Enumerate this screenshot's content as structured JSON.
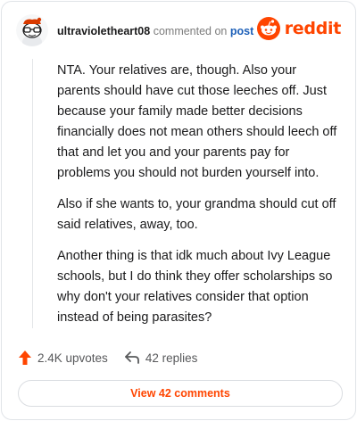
{
  "header": {
    "username": "ultravioletheart08",
    "action_text": "commented on",
    "post_link": "post",
    "brand": "reddit",
    "brand_color": "#ff4500"
  },
  "comment": {
    "paragraphs": [
      "NTA. Your relatives are, though. Also your parents should have cut those leeches off. Just because your family made better decisions financially does not mean others should leech off that and let you and your parents pay for problems you should not burden yourself into.",
      "Also if she wants to, your grandma should cut off said relatives, away, too.",
      "Another thing is that idk much about Ivy League schools, but I do think they offer scholarships so why don't your relatives consider that option instead of being parasites?"
    ]
  },
  "stats": {
    "upvotes": "2.4K upvotes",
    "replies": "42 replies",
    "upvote_icon": "upvote-arrow-icon",
    "reply_icon": "reply-arrow-icon"
  },
  "footer": {
    "view_comments": "View 42 comments"
  }
}
